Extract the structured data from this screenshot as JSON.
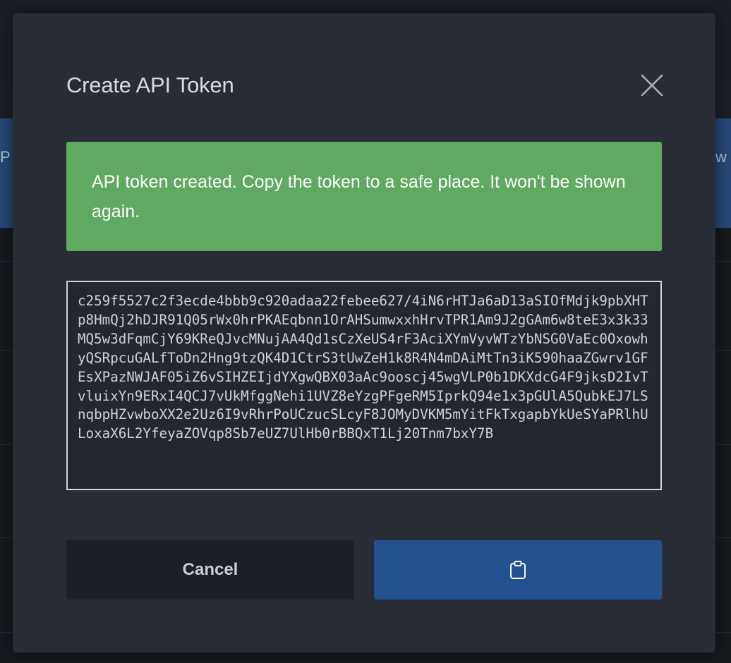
{
  "background": {
    "left_fragment": "PI",
    "right_fragment": "w"
  },
  "modal": {
    "title": "Create API Token",
    "close_icon": "close-icon",
    "alert": {
      "message": "API token created. Copy the token to a safe place. It won't be shown again.",
      "color": "#5fa960"
    },
    "token": "c259f5527c2f3ecde4bbb9c920adaa22febee627/4iN6rHTJa6aD13aSIOfMdjk9pbXHTp8HmQj2hDJR91Q05rWx0hrPKAEqbnn1OrAHSumwxxhHrvTPR1Am9J2gGAm6w8teE3x3k33MQ5w3dFqmCjY69KReQJvcMNujAA4Qd1sCzXeUS4rF3AciXYmVyvWTzYbNSG0VaEc0OxowhyQSRpcuGALfToDn2Hng9tzQK4D1CtrS3tUwZeH1k8R4N4mDAiMtTn3iK590haaZGwrv1GFEsXPazNWJAF05iZ6vSIHZEIjdYXgwQBX03aAc9ooscj45wgVLP0b1DKXdcG4F9jksD2IvTvluixYn9ERxI4QCJ7vUkMfggNehi1UVZ8eYzgPFgeRM5IprkQ94e1x3pGUlA5QubkEJ7LSnqbpHZvwboXX2e2Uz6I9vRhrPoUCzucSLcyF8JOMyDVKM5mYitFkTxgapbYkUeSYaPRlhULoxaX6L2YfeyaZOVqp8Sb7eUZ7UlHb0rBBQxT1Lj20Tnm7bxY7B",
    "buttons": {
      "cancel_label": "Cancel",
      "copy_icon": "clipboard-icon",
      "copy_color": "#24528f"
    }
  }
}
